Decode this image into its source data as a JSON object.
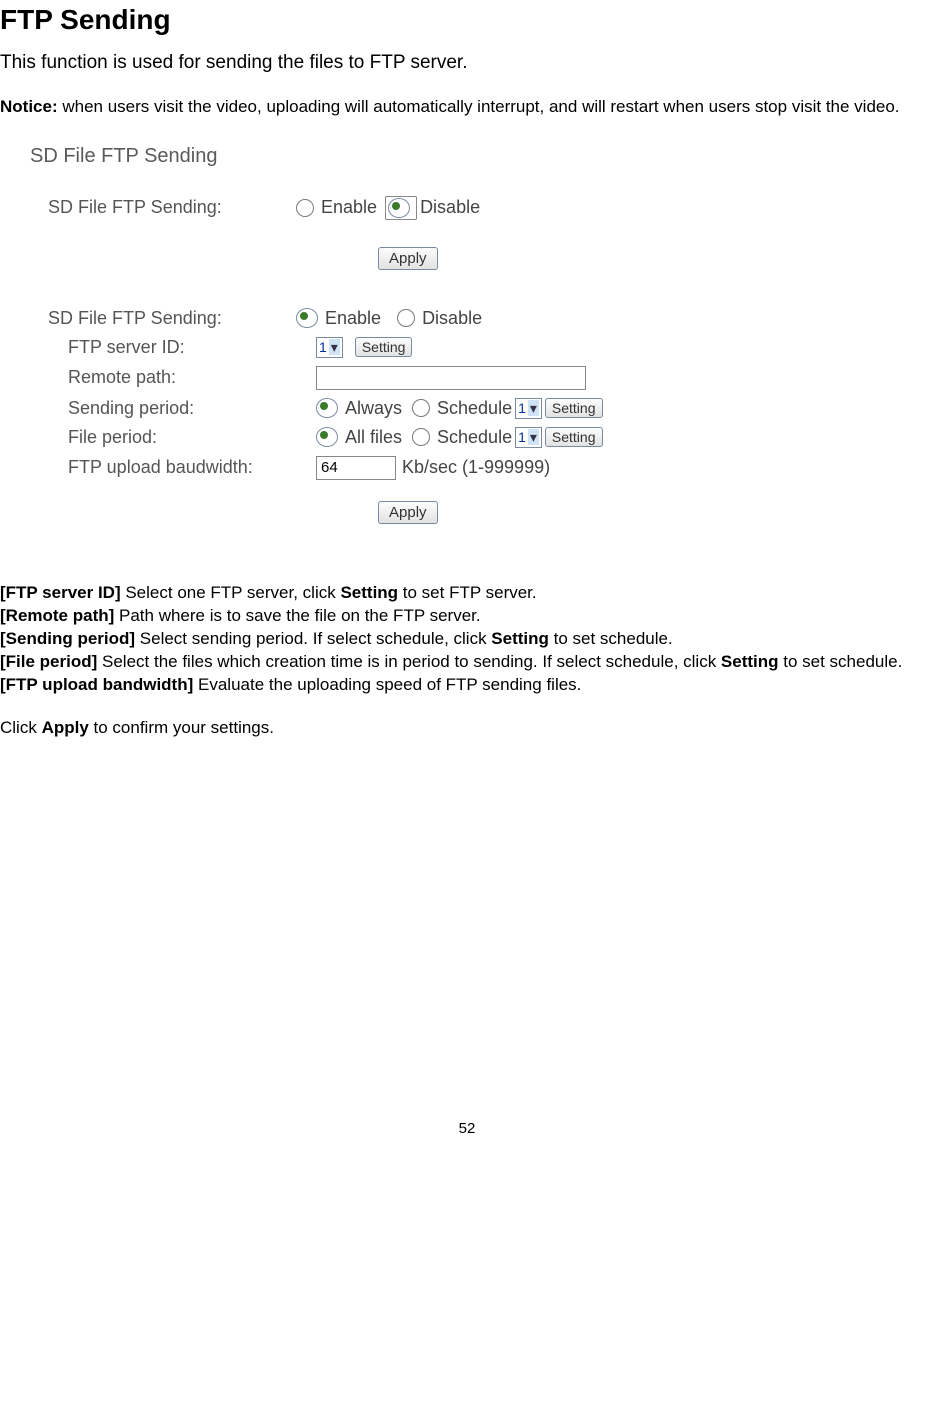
{
  "heading": "FTP Sending",
  "intro": "This function is used for sending the files to FTP server.",
  "notice_label": "Notice:",
  "notice_text": " when users visit the video, uploading will automatically interrupt, and will restart when users stop visit the video.",
  "panel1": {
    "title": "SD File FTP Sending",
    "row_label": "SD File FTP Sending:",
    "opt_enable": "Enable",
    "opt_disable": "Disable",
    "apply": "Apply"
  },
  "panel2": {
    "row_label": "SD File FTP Sending:",
    "opt_enable": "Enable",
    "opt_disable": "Disable",
    "ftp_id_label": "FTP server ID:",
    "ftp_id_value": "1",
    "setting": "Setting",
    "remote_path_label": "Remote path:",
    "remote_path_value": "",
    "sending_period_label": "Sending period:",
    "sp_always": "Always",
    "sp_schedule": "Schedule",
    "sp_sched_value": "1",
    "file_period_label": "File period:",
    "fp_all": "All files",
    "fp_schedule": "Schedule",
    "fp_sched_value": "1",
    "bw_label": "FTP upload baudwidth:",
    "bw_value": "64",
    "bw_unit": "Kb/sec (1-999999)",
    "apply": "Apply"
  },
  "defs": {
    "d1a": "[FTP server ID]",
    "d1b": " Select one FTP server, click ",
    "d1c": "Setting",
    "d1d": " to set FTP server.",
    "d2a": "[Remote path]",
    "d2b": " Path where is to save the file on the FTP server.",
    "d3a": "[Sending period]",
    "d3b": " Select sending period. If select schedule, click ",
    "d3c": "Setting",
    "d3d": " to set schedule.",
    "d4a": "[File period]",
    "d4b": " Select the files which creation time is in period to sending. If select schedule, click ",
    "d4c": "Setting",
    "d4d": " to set schedule.",
    "d5a": "[FTP upload bandwidth]",
    "d5b": " Evaluate the uploading speed of FTP sending files.",
    "d6a": "Click ",
    "d6b": "Apply",
    "d6c": " to confirm your settings."
  },
  "page_number": "52"
}
